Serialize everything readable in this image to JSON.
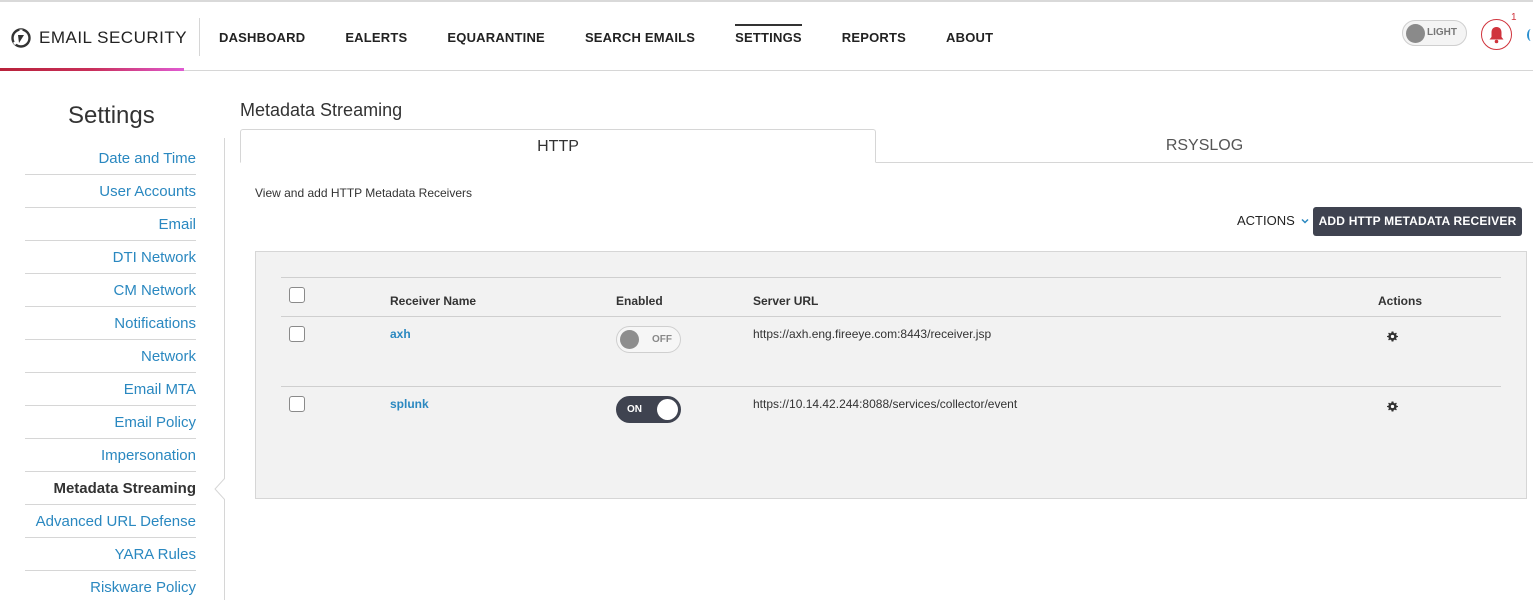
{
  "header": {
    "brand": "EMAIL SECURITY",
    "nav": [
      "DASHBOARD",
      "EALERTS",
      "EQUARANTINE",
      "SEARCH EMAILS",
      "SETTINGS",
      "REPORTS",
      "ABOUT"
    ],
    "active_nav": "SETTINGS",
    "theme_label": "LIGHT",
    "notification_count": "1"
  },
  "sidebar": {
    "title": "Settings",
    "items": [
      "Date and Time",
      "User Accounts",
      "Email",
      "DTI Network",
      "CM Network",
      "Notifications",
      "Network",
      "Email MTA",
      "Email Policy",
      "Impersonation",
      "Metadata Streaming",
      "Advanced URL Defense",
      "YARA Rules",
      "Riskware Policy"
    ],
    "active_item": "Metadata Streaming"
  },
  "main": {
    "title": "Metadata Streaming",
    "tabs": [
      "HTTP",
      "RSYSLOG"
    ],
    "active_tab": "HTTP",
    "help_text": "View and add HTTP Metadata Receivers",
    "actions_label": "ACTIONS",
    "add_button_label": "ADD HTTP METADATA RECEIVER",
    "table": {
      "columns": {
        "receiver_name": "Receiver Name",
        "enabled": "Enabled",
        "server_url": "Server URL",
        "actions": "Actions"
      },
      "rows": [
        {
          "name": "axh",
          "enabled": false,
          "toggle_label": "OFF",
          "url": "https://axh.eng.fireeye.com:8443/receiver.jsp"
        },
        {
          "name": "splunk",
          "enabled": true,
          "toggle_label": "ON",
          "url": "https://10.14.42.244:8088/services/collector/event"
        }
      ]
    }
  },
  "colors": {
    "link": "#2a88c0",
    "primary_button": "#3f4350",
    "alert": "#d0333c",
    "brand_gradient_start": "#b8223a",
    "brand_gradient_end": "#e05bd3"
  }
}
